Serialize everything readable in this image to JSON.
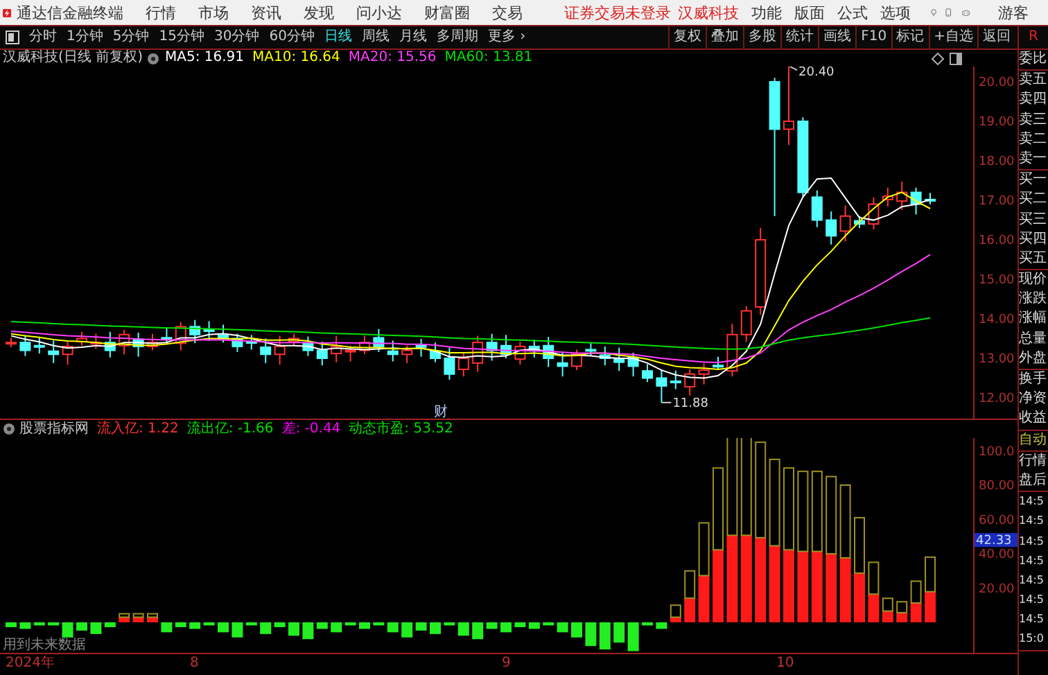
{
  "app_bar": {
    "app_name": "通达信金融终端",
    "menus": [
      "行情",
      "市场",
      "资讯",
      "发现",
      "问小达",
      "财富圈",
      "交易"
    ],
    "login_notice": "证券交易未登录",
    "stock_name": "汉威科技",
    "tools": [
      "功能",
      "版面",
      "公式",
      "选项"
    ],
    "user": "游客"
  },
  "period_bar": {
    "periods": [
      {
        "label": "分时",
        "selected": false
      },
      {
        "label": "1分钟",
        "selected": false
      },
      {
        "label": "5分钟",
        "selected": false
      },
      {
        "label": "15分钟",
        "selected": false
      },
      {
        "label": "30分钟",
        "selected": false
      },
      {
        "label": "60分钟",
        "selected": false
      },
      {
        "label": "日线",
        "selected": true
      },
      {
        "label": "周线",
        "selected": false
      },
      {
        "label": "月线",
        "selected": false
      },
      {
        "label": "多周期",
        "selected": false
      }
    ],
    "more": "更多 ›",
    "actions": [
      "复权",
      "叠加",
      "多股",
      "统计",
      "画线",
      "F10",
      "标记",
      "+自选",
      "返回"
    ],
    "corner": "R"
  },
  "price_chart": {
    "title": "汉威科技(日线 前复权)",
    "moving_averages": [
      {
        "label": "MA5: 16.91",
        "color": "#ffffff"
      },
      {
        "label": "MA10: 16.64",
        "color": "#ffff00"
      },
      {
        "label": "MA20: 15.56",
        "color": "#ff40ff"
      },
      {
        "label": "MA60: 13.81",
        "color": "#00e000"
      }
    ],
    "axis_labels": [
      "20.00",
      "19.00",
      "18.00",
      "17.00",
      "16.00",
      "15.00",
      "14.00",
      "13.00",
      "12.00"
    ],
    "high_label": "20.40",
    "low_label": "11.88",
    "event_marker": "财"
  },
  "indicator": {
    "title": "股票指标网",
    "values": [
      {
        "label": "流入亿: 1.22",
        "color": "#ff3232"
      },
      {
        "label": "流出亿: -1.66",
        "color": "#00e000"
      },
      {
        "label": "差: -0.44",
        "color": "#ff00ff"
      },
      {
        "label": "动态市盈: 53.52",
        "color": "#00e000"
      }
    ],
    "axis_labels": [
      "100.0",
      "80.00",
      "60.00",
      "40.00",
      "20.00"
    ],
    "cursor_value": "42.33",
    "note": "用到未来数据"
  },
  "date_axis": [
    "2024年",
    "8",
    "9",
    "10"
  ],
  "quote_panel": [
    {
      "kind": "field",
      "items": [
        "委比"
      ]
    },
    {
      "kind": "field",
      "items": [
        "卖五",
        "卖四",
        "卖三",
        "卖二",
        "卖一"
      ]
    },
    {
      "kind": "field",
      "items": [
        "买一",
        "买二",
        "买三",
        "买四",
        "买五"
      ]
    },
    {
      "kind": "field",
      "items": [
        "现价",
        "涨跌",
        "涨幅",
        "总量",
        "外盘"
      ]
    },
    {
      "kind": "field",
      "items": [
        "换手",
        "净资",
        "收益"
      ]
    },
    {
      "kind": "mode",
      "items": [
        "自动"
      ]
    },
    {
      "kind": "field",
      "items": [
        "行情",
        "盘后"
      ]
    },
    {
      "kind": "time",
      "items": [
        "14:5",
        "14:5",
        "14:5",
        "14:5",
        "14:5",
        "14:5",
        "14:5",
        "15:0"
      ]
    }
  ]
}
